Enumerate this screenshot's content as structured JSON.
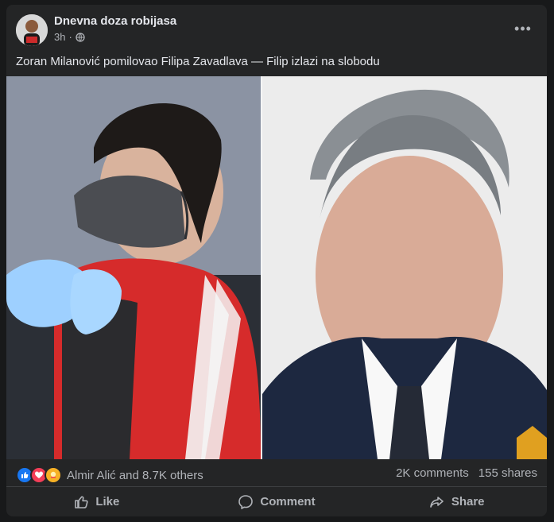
{
  "post": {
    "author": "Dnevna doza robijasa",
    "time": "3h",
    "privacy_icon": "globe-icon",
    "text": "Zoran Milanović pomilovao Filipa Zavadlava — Filip izlazi na slobodu"
  },
  "stats": {
    "reactions_text": "Almir Alić and 8.7K others",
    "comments": "2K comments",
    "shares": "155 shares"
  },
  "actions": {
    "like": "Like",
    "comment": "Comment",
    "share": "Share"
  },
  "colors": {
    "card": "#242526",
    "text_primary": "#e4e6eb",
    "text_secondary": "#b0b3b8",
    "like_blue": "#1877f2",
    "love_red": "#f33e58",
    "care_yellow": "#f7b125"
  }
}
